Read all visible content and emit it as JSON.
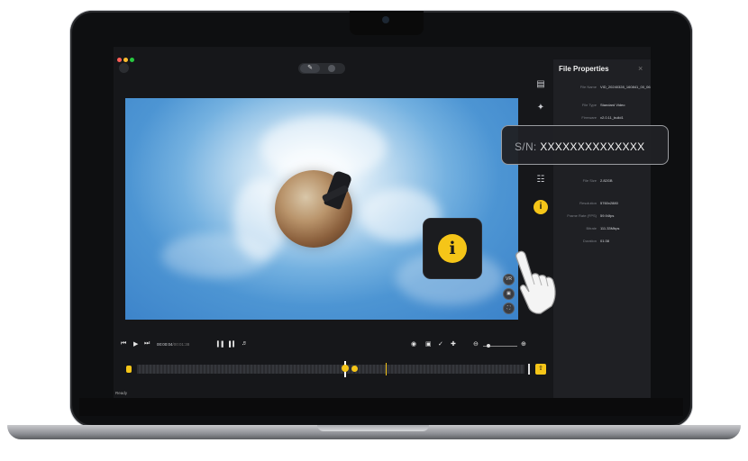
{
  "app": {
    "status_text": "Ready"
  },
  "toolbar": {
    "mode_active_icon": "edit-icon",
    "mode_other_icon": "circle-icon"
  },
  "panel": {
    "title": "File Properties",
    "close_icon": "close-icon",
    "rows": [
      {
        "label": "File Name",
        "value": "VID_20240328_160841_00_063.insv"
      },
      {
        "label": "File Type",
        "value": "Standard Video"
      },
      {
        "label": "Firmware",
        "value": "v2.0.11_build1"
      },
      {
        "label": "File Size",
        "value": "2.82GB"
      },
      {
        "label": "Resolution",
        "value": "5760x2880"
      },
      {
        "label": "Frame Rate (FPS)",
        "value": "59.94fps"
      },
      {
        "label": "Bitrate",
        "value": "111.33Mbps"
      },
      {
        "label": "Duration",
        "value": "01:38"
      }
    ]
  },
  "player": {
    "time_current": "00:00:04",
    "time_total": "/00:01:38"
  },
  "callouts": {
    "serial_label": "S/N:",
    "serial_value": "XXXXXXXXXXXXXX",
    "info_glyph": "i"
  },
  "colors": {
    "accent": "#f5c518",
    "panel_bg": "#1f2024",
    "app_bg": "#16171a"
  }
}
